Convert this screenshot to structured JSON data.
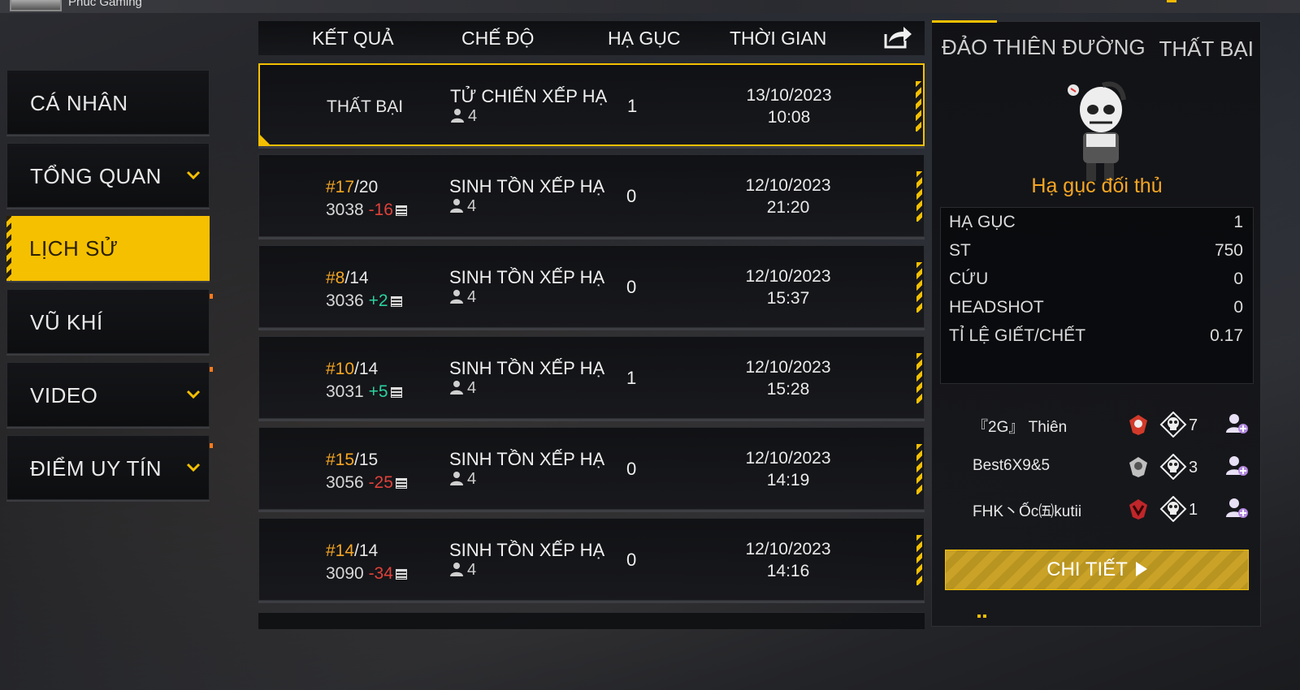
{
  "header": {
    "player_name_partial": "Phúc   Gaming"
  },
  "menu": {
    "items": [
      {
        "label": "CÁ NHÂN",
        "has_chevron": false
      },
      {
        "label": "TỔNG QUAN",
        "has_chevron": true
      },
      {
        "label": "LỊCH SỬ",
        "has_chevron": false,
        "active": true
      },
      {
        "label": "VŨ KHÍ",
        "has_chevron": false
      },
      {
        "label": "VIDEO",
        "has_chevron": true
      },
      {
        "label": "ĐIỂM UY TÍN",
        "has_chevron": true
      }
    ]
  },
  "table": {
    "headers": {
      "result": "KẾT QUẢ",
      "mode": "CHẾ ĐỘ",
      "kills": "HẠ GỤC",
      "time": "THỜI GIAN"
    },
    "rows": [
      {
        "result": "THẤT BẠI",
        "mode": "TỬ CHIẾN XẾP HẠ",
        "players": "4",
        "kills": "1",
        "date": "13/10/2023",
        "time": "10:08"
      },
      {
        "rank": "#17",
        "total": "/20",
        "points": "3038",
        "delta": "-16",
        "mode": "SINH TỒN XẾP HẠ",
        "players": "4",
        "kills": "0",
        "date": "12/10/2023",
        "time": "21:20"
      },
      {
        "rank": "#8",
        "total": "/14",
        "points": "3036",
        "delta": "+2",
        "mode": "SINH TỒN XẾP HẠ",
        "players": "4",
        "kills": "0",
        "date": "12/10/2023",
        "time": "15:37"
      },
      {
        "rank": "#10",
        "total": "/14",
        "points": "3031",
        "delta": "+5",
        "mode": "SINH TỒN XẾP HẠ",
        "players": "4",
        "kills": "1",
        "date": "12/10/2023",
        "time": "15:28"
      },
      {
        "rank": "#15",
        "total": "/15",
        "points": "3056",
        "delta": "-25",
        "mode": "SINH TỒN XẾP HẠ",
        "players": "4",
        "kills": "0",
        "date": "12/10/2023",
        "time": "14:19"
      },
      {
        "rank": "#14",
        "total": "/14",
        "points": "3090",
        "delta": "-34",
        "mode": "SINH TỒN XẾP HẠ",
        "players": "4",
        "kills": "0",
        "date": "12/10/2023",
        "time": "14:16"
      }
    ]
  },
  "detail": {
    "map": "ĐẢO THIÊN ĐƯỜNG",
    "outcome": "THẤT BẠI",
    "killer_caption": "Hạ gục đối thủ",
    "stats": [
      {
        "label": "HẠ GỤC",
        "value": "1"
      },
      {
        "label": "ST",
        "value": "750"
      },
      {
        "label": "CỨU",
        "value": "0"
      },
      {
        "label": "HEADSHOT",
        "value": "0"
      },
      {
        "label": "TỈ LỆ GIẾT/CHẾT",
        "value": "0.17"
      }
    ],
    "teammates": [
      {
        "name": "『2G』 Thiên",
        "kills": "7",
        "badge_color": "#d23a2a"
      },
      {
        "name": "Best6X9&5",
        "kills": "3",
        "badge_color": "#bfbfbf"
      },
      {
        "name": "FHK丶Ốc㈤kutii",
        "kills": "1",
        "badge_color": "#c0262a"
      }
    ],
    "button_label": "CHI TIẾT"
  },
  "colors": {
    "accent": "#f5c000",
    "rank": "#f5a623",
    "negative": "#e0413a",
    "positive": "#2bd2a0"
  }
}
